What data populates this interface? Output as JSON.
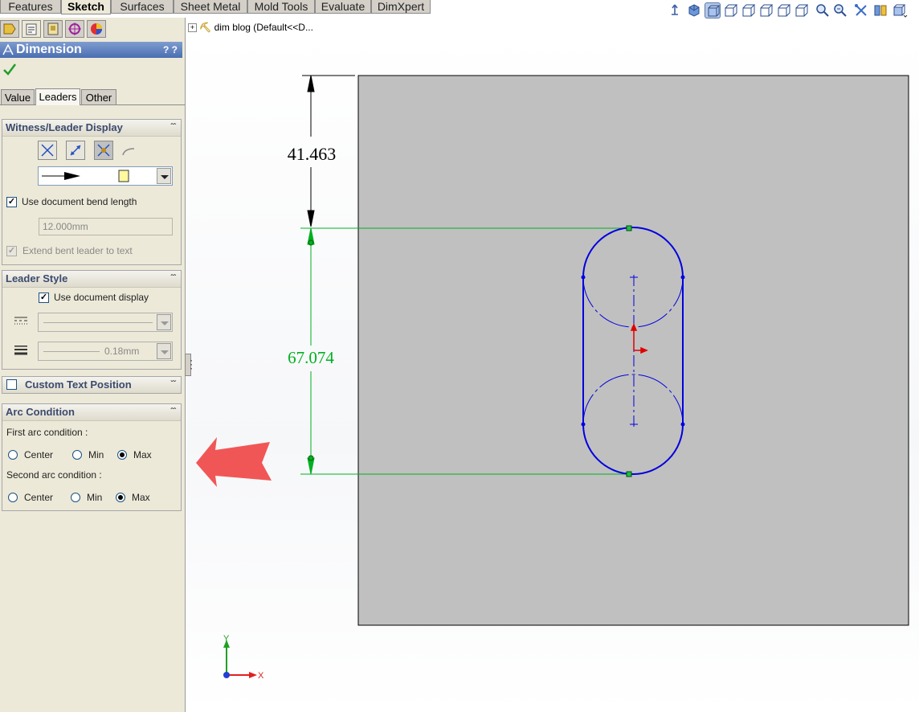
{
  "command_tabs": [
    "Features",
    "Sketch",
    "Surfaces",
    "Sheet Metal",
    "Mold Tools",
    "Evaluate",
    "DimXpert"
  ],
  "active_command_tab": "Sketch",
  "heads_up_toolbar": [
    "view-orientation-icon",
    "3d-cube-icon",
    "shaded-cube-icon",
    "cube-view-icon",
    "cube-view-icon",
    "cube-view-icon",
    "cube-view-icon",
    "cube-view-icon",
    "zoom-icon",
    "zoom-area-icon",
    "tools-icon",
    "section-view-icon",
    "display-cube-icon"
  ],
  "property_manager": {
    "title": "Dimension",
    "help": "? ?",
    "tabs": [
      "Value",
      "Leaders",
      "Other"
    ],
    "active_tab": "Leaders",
    "witness_leader": {
      "title": "Witness/Leader Display",
      "use_doc_bend_length": "Use document bend length",
      "bend_length_value": "12.000mm",
      "extend_bent_leader": "Extend bent leader to text"
    },
    "leader_style": {
      "title": "Leader Style",
      "use_doc_display": "Use document display",
      "line_thickness": "0.18mm"
    },
    "custom_text_position": {
      "title": "Custom Text Position"
    },
    "arc_condition": {
      "title": "Arc Condition",
      "first_label": "First arc condition :",
      "second_label": "Second arc condition :",
      "options": [
        "Center",
        "Min",
        "Max"
      ],
      "first_selected": "Max",
      "second_selected": "Max"
    }
  },
  "feature_tree": {
    "item": "dim blog  (Default<<D..."
  },
  "drawing": {
    "dim_top": "41.463",
    "dim_main": "67.074",
    "axis_y": "Y",
    "axis_x": "X"
  },
  "colors": {
    "sketch_blue": "#0000e0",
    "dimension_green": "#00b020",
    "plane_gray": "#c0c0c0",
    "highlight_arrow": "#f04040"
  }
}
